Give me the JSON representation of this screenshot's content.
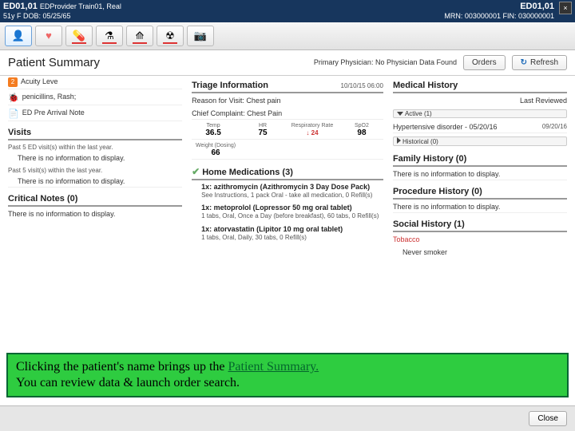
{
  "titlebar": {
    "left_primary": "ED01,01",
    "left_secondary": "EDProvider Train01, Real",
    "left_sub": "51y   F   DOB: 05/25/65",
    "right_primary": "ED01,01",
    "right_sub": "MRN: 003000001   FIN: 030000001"
  },
  "toolbar": {
    "icons": [
      "person-icon",
      "heart-icon",
      "pill-icon",
      "flask-icon",
      "vitals-icon",
      "radiation-icon",
      "camera-icon"
    ]
  },
  "header": {
    "title": "Patient Summary",
    "phys_label": "Primary Physician:",
    "phys_value": "No Physician Data Found",
    "orders_btn": "Orders",
    "refresh_btn": "Refresh"
  },
  "col1": {
    "acuity_badge": "2",
    "acuity_label": "Acuity Leve",
    "allergy": "penicillins, Rash;",
    "prearrival": "ED Pre Arrival Note",
    "visits_title": "Visits",
    "visits_sub1": "Past 5 ED visit(s) within the last year.",
    "visits_empty": "There is no information to display.",
    "visits_sub2": "Past 5 visit(s) within the last year.",
    "crit_title": "Critical Notes (0)",
    "crit_empty": "There is no information to display."
  },
  "col2": {
    "triage_title": "Triage Information",
    "triage_ts": "10/10/15 06:00",
    "reason": "Reason for Visit: Chest pain",
    "chief": "Chief Complaint: Chest Pain",
    "v_temp_l": "Temp",
    "v_temp": "36.5",
    "v_hr_l": "HR",
    "v_hr": "75",
    "v_rr_l": "Respiratory Rate",
    "v_rr": "↓ 24",
    "v_spo2_l": "SpO2",
    "v_spo2": "98",
    "v_wt_l": "Weight (Dosing)",
    "v_wt": "66",
    "meds_title": "Home Medications (3)",
    "med1_name": "1x: azithromycin (Azithromycin 3 Day Dose Pack)",
    "med1_sig": "See Instructions, 1 pack Oral - take all medication, 0 Refill(s)",
    "med2_name": "1x: metoprolol (Lopressor 50 mg oral tablet)",
    "med2_sig": "1 tabs, Oral, Once a Day (before breakfast), 60 tabs, 0 Refill(s)",
    "med3_name": "1x: atorvastatin (Lipitor 10 mg oral tablet)",
    "med3_sig": "1 tabs, Oral, Daily, 30 tabs, 0 Refill(s)"
  },
  "col3": {
    "mh_title": "Medical History",
    "mh_sub": "Last Reviewed",
    "mh_active": "Active (1)",
    "mh_item": "Hypertensive disorder - 05/20/16",
    "mh_item_date": "09/20/16",
    "mh_hist": "Historical (0)",
    "fh_title": "Family History (0)",
    "fh_empty": "There is no information to display.",
    "ph_title": "Procedure History (0)",
    "ph_empty": "There is no information to display.",
    "sh_title": "Social History (1)",
    "sh_item": "Tobacco",
    "sh_val": "Never smoker"
  },
  "callout": {
    "text1": "Clicking the patient's name brings up the ",
    "text_u": "Patient Summary.",
    "text2": "You can review data & launch order search."
  },
  "footer": {
    "close": "Close"
  }
}
